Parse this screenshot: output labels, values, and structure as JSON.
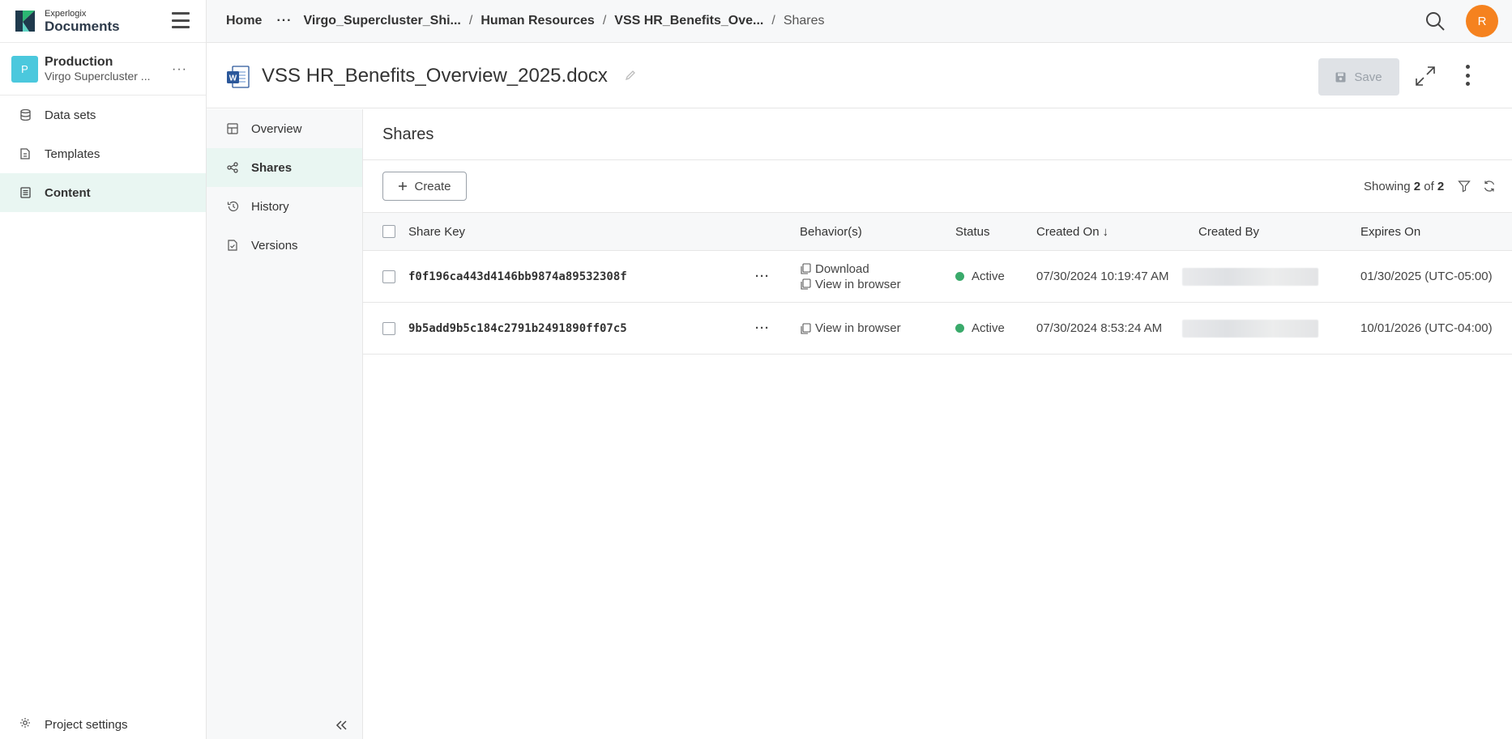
{
  "app": {
    "brand_small": "Experlogix",
    "brand_big": "Documents"
  },
  "project": {
    "avatar": "P",
    "name": "Production",
    "subtitle": "Virgo Supercluster ..."
  },
  "leftnav": {
    "items": [
      {
        "label": "Data sets",
        "icon": "database-icon"
      },
      {
        "label": "Templates",
        "icon": "template-file-icon"
      },
      {
        "label": "Content",
        "icon": "content-list-icon",
        "active": true
      }
    ],
    "settings_label": "Project settings"
  },
  "breadcrumb": {
    "home": "Home",
    "ellipsis": "···",
    "items": [
      "Virgo_Supercluster_Shi...",
      "Human Resources",
      "VSS HR_Benefits_Ove...",
      "Shares"
    ]
  },
  "user": {
    "initial": "R"
  },
  "document": {
    "title": "VSS HR_Benefits_Overview_2025.docx",
    "save_label": "Save"
  },
  "subnav": {
    "items": [
      {
        "label": "Overview",
        "icon": "grid-icon"
      },
      {
        "label": "Shares",
        "icon": "share-icon",
        "active": true
      },
      {
        "label": "History",
        "icon": "history-icon"
      },
      {
        "label": "Versions",
        "icon": "versions-icon"
      }
    ]
  },
  "shares": {
    "title": "Shares",
    "create_label": "Create",
    "showing_prefix": "Showing",
    "showing_count": "2",
    "showing_of": "of",
    "showing_total": "2",
    "columns": {
      "share_key": "Share Key",
      "behaviors": "Behavior(s)",
      "status": "Status",
      "created_on": "Created On",
      "created_on_sort": "↓",
      "created_by": "Created By",
      "expires_on": "Expires On"
    },
    "rows": [
      {
        "key": "f0f196ca443d4146bb9874a89532308f",
        "more": "···",
        "behaviors": [
          "Download",
          "View in browser"
        ],
        "status": "Active",
        "created_on": "07/30/2024 10:19:47 AM",
        "expires_on": "01/30/2025 (UTC-05:00)"
      },
      {
        "key": "9b5add9b5c184c2791b2491890ff07c5",
        "more": "···",
        "behaviors": [
          "View in browser"
        ],
        "status": "Active",
        "created_on": "07/30/2024 8:53:24 AM",
        "expires_on": "10/01/2026 (UTC-04:00)"
      }
    ]
  },
  "colors": {
    "accent_active_bg": "#e9f6f2",
    "status_active": "#3aaa6b",
    "avatar_orange": "#f5821f",
    "project_avatar": "#4bc8dd"
  }
}
